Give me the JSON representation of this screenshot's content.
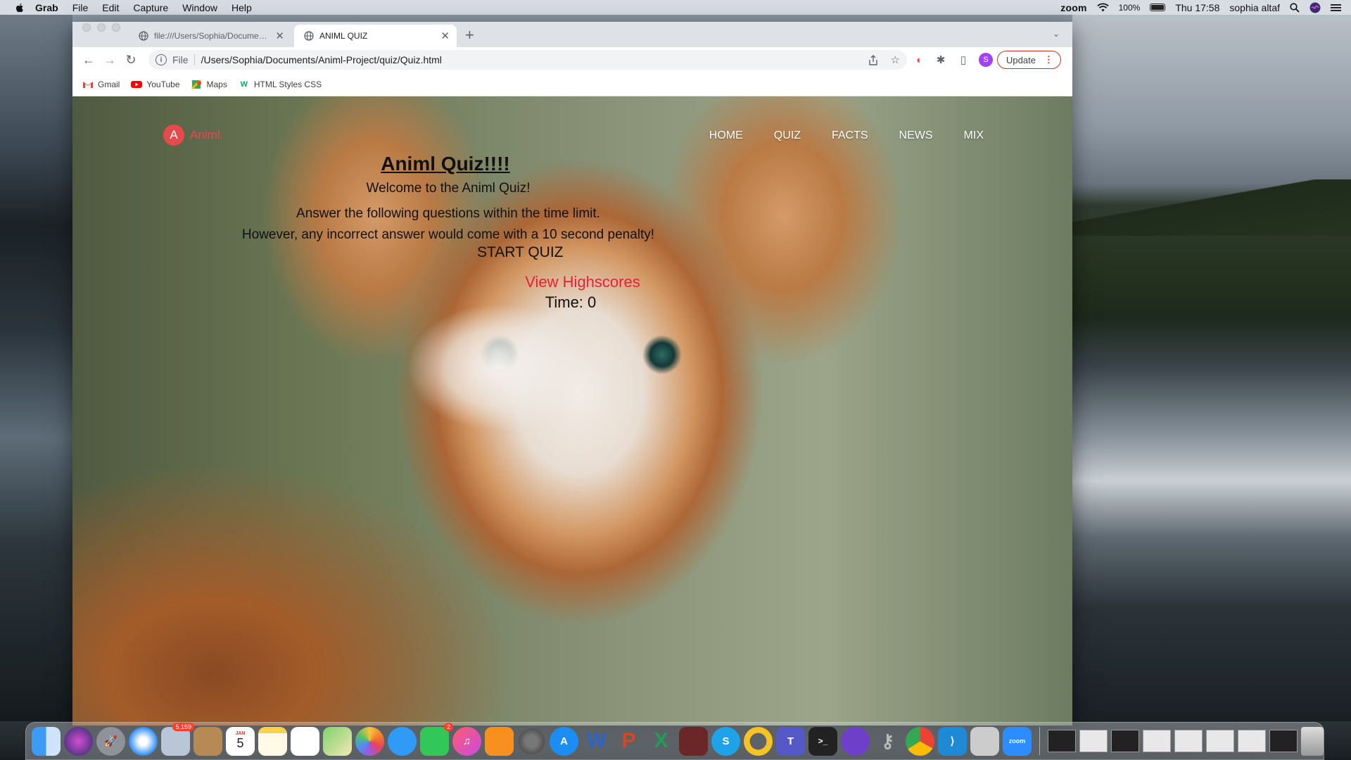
{
  "menubar": {
    "items": [
      "Grab",
      "File",
      "Edit",
      "Capture",
      "Window",
      "Help"
    ],
    "zoom": "zoom",
    "battery": "100%",
    "clock": "Thu 17:58",
    "user": "sophia altaf"
  },
  "browser": {
    "tabs": [
      {
        "title": "file:///Users/Sophia/Documents/Animl-Project/quiz/Quiz.html"
      },
      {
        "title": "ANIML QUIZ"
      }
    ],
    "address": {
      "scheme": "File",
      "url": "/Users/Sophia/Documents/Animl-Project/quiz/Quiz.html"
    },
    "profile_initial": "S",
    "update_label": "Update",
    "bookmarks": [
      {
        "label": "Gmail",
        "icon": "gmail-icon"
      },
      {
        "label": "YouTube",
        "icon": "youtube-icon"
      },
      {
        "label": "Maps",
        "icon": "maps-icon"
      },
      {
        "label": "HTML Styles CSS",
        "icon": "w3schools-icon"
      }
    ]
  },
  "site": {
    "logo_letter": "A",
    "logo_name": "Animl.",
    "nav": [
      "HOME",
      "QUIZ",
      "FACTS",
      "NEWS",
      "MIX"
    ],
    "title": "Animl Quiz!!!!",
    "welcome": "Welcome to the Animl Quiz!",
    "instructions": [
      "Answer the following questions within the time limit.",
      "However, any incorrect answer would come with a 10 second penalty!"
    ],
    "start_label": "START QUIZ",
    "highscores_label": "View Highscores",
    "timer_label": "Time: 0"
  },
  "dock": {
    "mail_badge": "5,159",
    "calendar_month": "JAN",
    "calendar_day": "5",
    "facetime_badge": "2",
    "zoom_label": "zoom"
  },
  "colors": {
    "logo_red": "#e64a4a",
    "highscores_red": "#e81e3a",
    "update_border": "#d93025"
  }
}
